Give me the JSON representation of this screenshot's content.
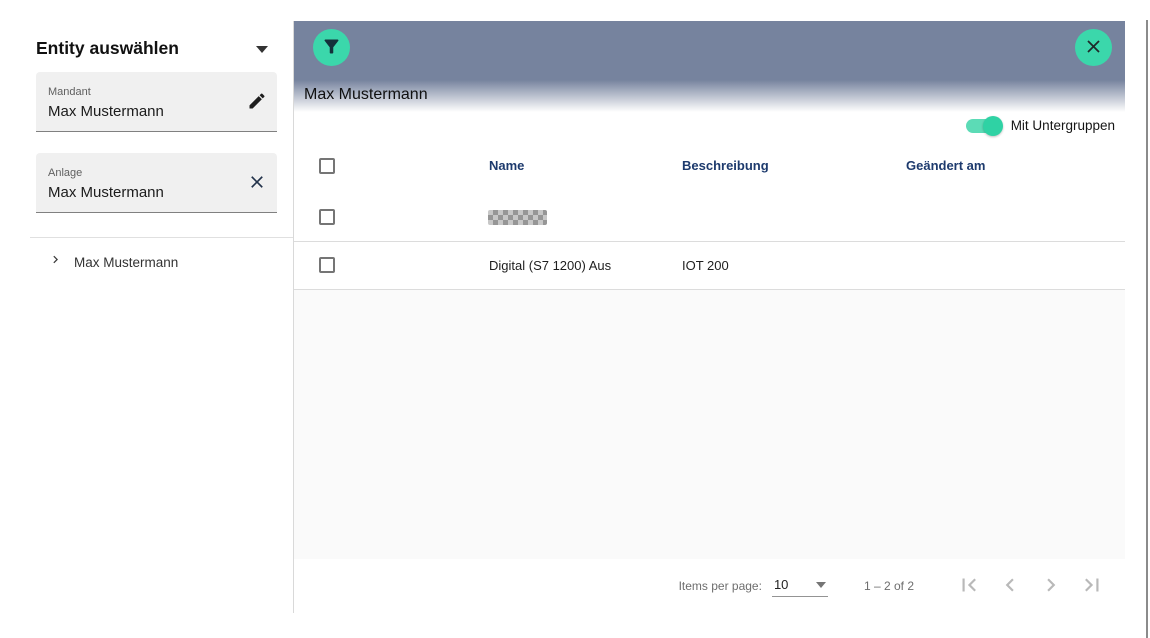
{
  "sidebar": {
    "title": "Entity auswählen",
    "fields": [
      {
        "label": "Mandant",
        "value": "Max Mustermann",
        "action_icon": "edit-pencil-icon"
      },
      {
        "label": "Anlage",
        "value": "Max Mustermann",
        "action_icon": "clear-x-icon"
      }
    ],
    "tree_item": "Max Mustermann"
  },
  "panel": {
    "title": "Max Mustermann",
    "toggle": {
      "label": "Mit Untergruppen",
      "state": "on"
    },
    "table": {
      "columns": [
        "Name",
        "Beschreibung",
        "Geändert am"
      ],
      "rows": [
        {
          "name": "",
          "beschreibung": "",
          "geaendert_am": "",
          "redacted": true
        },
        {
          "name": "Digital (S7 1200) Aus",
          "beschreibung": "IOT 200",
          "geaendert_am": "",
          "redacted": false
        }
      ]
    },
    "paginator": {
      "items_per_page_label": "Items per page:",
      "page_size": "10",
      "range": "1 – 2 of 2"
    }
  },
  "icons": {
    "top_left": "filter-funnel-icon",
    "top_right": "close-x-icon",
    "pagination": [
      "first-page-icon",
      "previous-page-icon",
      "next-page-icon",
      "last-page-icon"
    ]
  },
  "colors": {
    "accent_teal": "#3bd7ab",
    "topbar_slate": "#76839e",
    "column_header_navy": "#1d3a6d"
  }
}
